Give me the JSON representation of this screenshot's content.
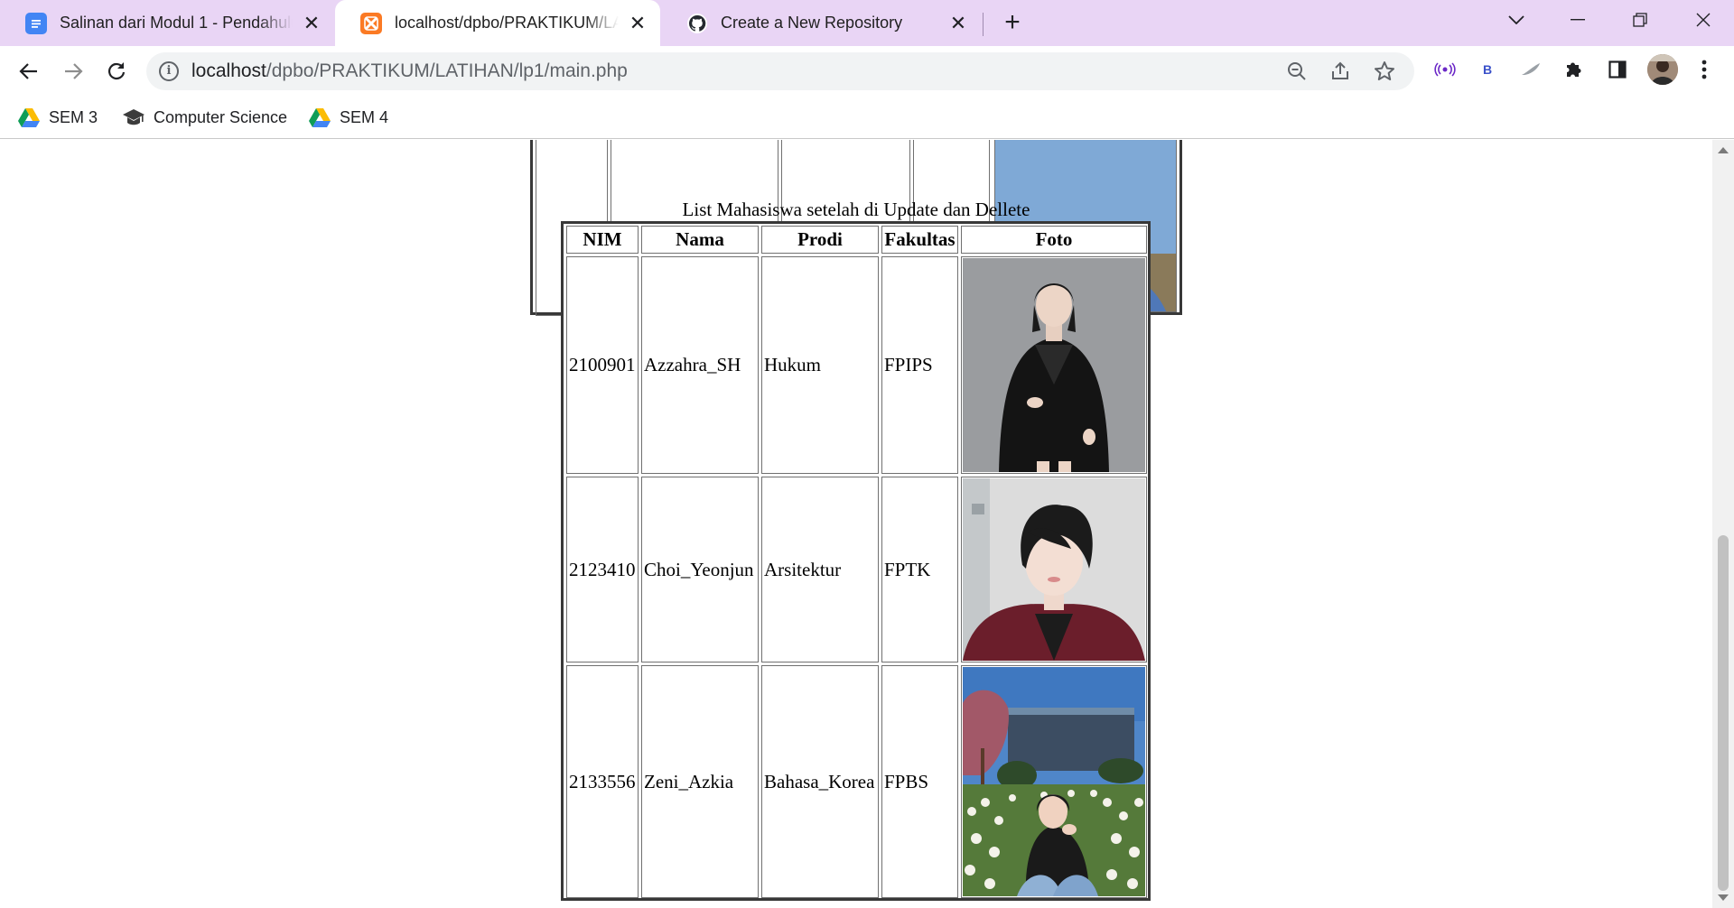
{
  "browser": {
    "tabs": [
      {
        "title": "Salinan dari Modul 1 - Pendahuluan",
        "icon": "google-docs-icon",
        "active": false
      },
      {
        "title": "localhost/dpbo/PRAKTIKUM/LATIHAN/lp1/main.php",
        "icon": "xampp-icon",
        "active": true
      },
      {
        "title": "Create a New Repository",
        "icon": "github-icon",
        "active": false
      }
    ],
    "url_host": "localhost",
    "url_path": "/dpbo/PRAKTIKUM/LATIHAN/lp1/main.php",
    "extensions": [
      "broadcast-extension-icon",
      "b-extension-icon",
      "feather-extension-icon",
      "puzzle-extensions-icon",
      "side-panel-icon",
      "profile-avatar",
      "more-menu-icon"
    ],
    "bookmarks": [
      {
        "label": "SEM 3",
        "icon": "google-drive-icon"
      },
      {
        "label": "Computer Science",
        "icon": "graduation-cap-icon"
      },
      {
        "label": "SEM 4",
        "icon": "google-drive-icon"
      }
    ],
    "colors": {
      "tabstrip": "#e9d5f5",
      "omnibox": "#f1f3f4",
      "accent": "#6b28c7"
    }
  },
  "page": {
    "caption": "List Mahasiswa setelah di Update dan Dellete",
    "headers": [
      "NIM",
      "Nama",
      "Prodi",
      "Fakultas",
      "Foto"
    ],
    "rows": [
      {
        "nim": "2100901",
        "nama": "Azzahra_SH",
        "prodi": "Hukum",
        "fakultas": "FPIPS",
        "foto": "portrait-woman-black-suit"
      },
      {
        "nim": "2123410",
        "nama": "Choi_Yeonjun",
        "prodi": "Arsitektur",
        "fakultas": "FPTK",
        "foto": "portrait-man-maroon-jacket"
      },
      {
        "nim": "2133556",
        "nama": "Zeni_Azkia",
        "prodi": "Bahasa_Korea",
        "fakultas": "FPBS",
        "foto": "photo-woman-tulip-garden"
      }
    ]
  }
}
